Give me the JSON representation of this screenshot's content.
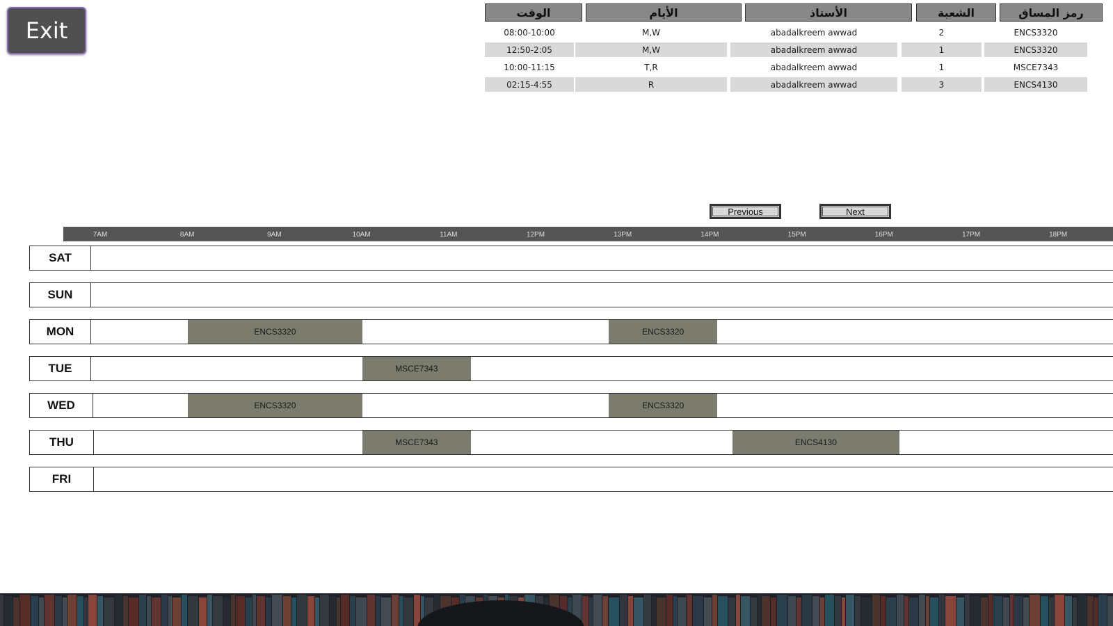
{
  "exit_label": "Exit",
  "table": {
    "headers": {
      "time": "الوقت",
      "days": "الأيام",
      "instructor": "الأستاذ",
      "section": "الشعبة",
      "course_code": "رمز المساق"
    },
    "rows": [
      {
        "time": "08:00-10:00",
        "days": "M,W",
        "instructor": "abadalkreem awwad",
        "section": "2",
        "course_code": "ENCS3320"
      },
      {
        "time": "12:50-2:05",
        "days": "M,W",
        "instructor": "abadalkreem awwad",
        "section": "1",
        "course_code": "ENCS3320"
      },
      {
        "time": "10:00-11:15",
        "days": "T,R",
        "instructor": "abadalkreem awwad",
        "section": "1",
        "course_code": "MSCE7343"
      },
      {
        "time": "02:15-4:55",
        "days": "R",
        "instructor": "abadalkreem awwad",
        "section": "3",
        "course_code": "ENCS4130"
      }
    ]
  },
  "nav": {
    "previous": "Previous",
    "next": "Next"
  },
  "timeline": {
    "ticks": [
      "7AM",
      "8AM",
      "9AM",
      "10AM",
      "11AM",
      "12PM",
      "13PM",
      "14PM",
      "15PM",
      "16PM",
      "17PM",
      "18PM"
    ]
  },
  "days": [
    {
      "label": "SAT",
      "blocks": []
    },
    {
      "label": "SUN",
      "blocks": []
    },
    {
      "label": "MON",
      "blocks": [
        {
          "course": "ENCS3320",
          "start_hour": 8.0,
          "end_hour": 10.0
        },
        {
          "course": "ENCS3320",
          "start_hour": 12.83,
          "end_hour": 14.08
        }
      ]
    },
    {
      "label": "TUE",
      "blocks": [
        {
          "course": "MSCE7343",
          "start_hour": 10.0,
          "end_hour": 11.25
        }
      ]
    },
    {
      "label": "WED",
      "blocks": [
        {
          "course": "ENCS3320",
          "start_hour": 8.0,
          "end_hour": 10.0
        },
        {
          "course": "ENCS3320",
          "start_hour": 12.83,
          "end_hour": 14.08
        }
      ]
    },
    {
      "label": "THU",
      "blocks": [
        {
          "course": "MSCE7343",
          "start_hour": 10.0,
          "end_hour": 11.25
        },
        {
          "course": "ENCS4130",
          "start_hour": 14.25,
          "end_hour": 16.17
        }
      ]
    },
    {
      "label": "FRI",
      "blocks": []
    }
  ],
  "colors": {
    "block": "#7b7c6e",
    "timebar": "#555555",
    "header_cell": "#888888",
    "shaded_row": "#d9d9d9"
  }
}
